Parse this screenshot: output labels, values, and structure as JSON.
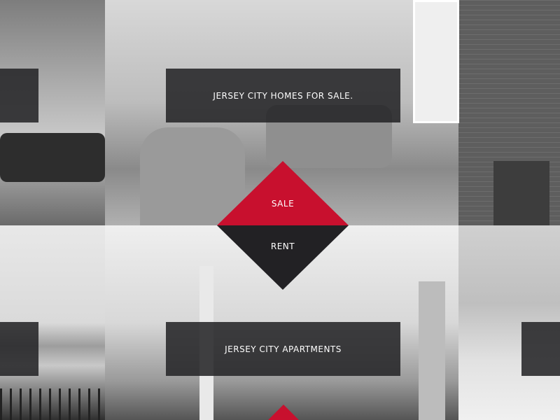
{
  "banners": {
    "homes_for_sale": "JERSEY CITY HOMES FOR SALE.",
    "apartments": "JERSEY CITY APARTMENTS"
  },
  "toggle": {
    "sale_label": "SALE",
    "rent_label": "RENT"
  },
  "colors": {
    "accent": "#c8102e",
    "overlay": "#262628",
    "rent_background": "#222124"
  }
}
